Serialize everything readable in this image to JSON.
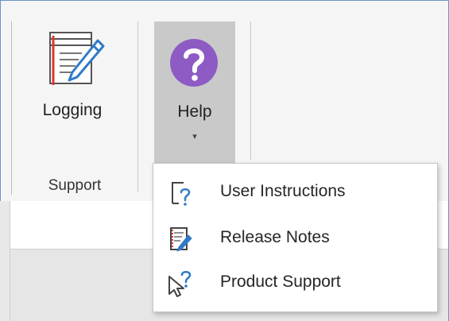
{
  "ribbon": {
    "logging": {
      "label": "Logging",
      "icon": "log-sheet-pencil-icon"
    },
    "help": {
      "label": "Help",
      "caret": "▾",
      "icon": "help-question-icon",
      "accent": "#8e5bc4"
    },
    "group_label": "Support"
  },
  "help_menu": {
    "items": [
      {
        "label": "User Instructions",
        "icon": "user-instructions-icon"
      },
      {
        "label": "Release Notes",
        "icon": "release-notes-icon"
      },
      {
        "label": "Product Support",
        "icon": "product-support-icon"
      }
    ]
  },
  "colors": {
    "icon_blue": "#2e7ac7",
    "accent_red": "#e0352b",
    "help_purple": "#8e5bc4",
    "pressed_bg": "#c9c9c9"
  }
}
